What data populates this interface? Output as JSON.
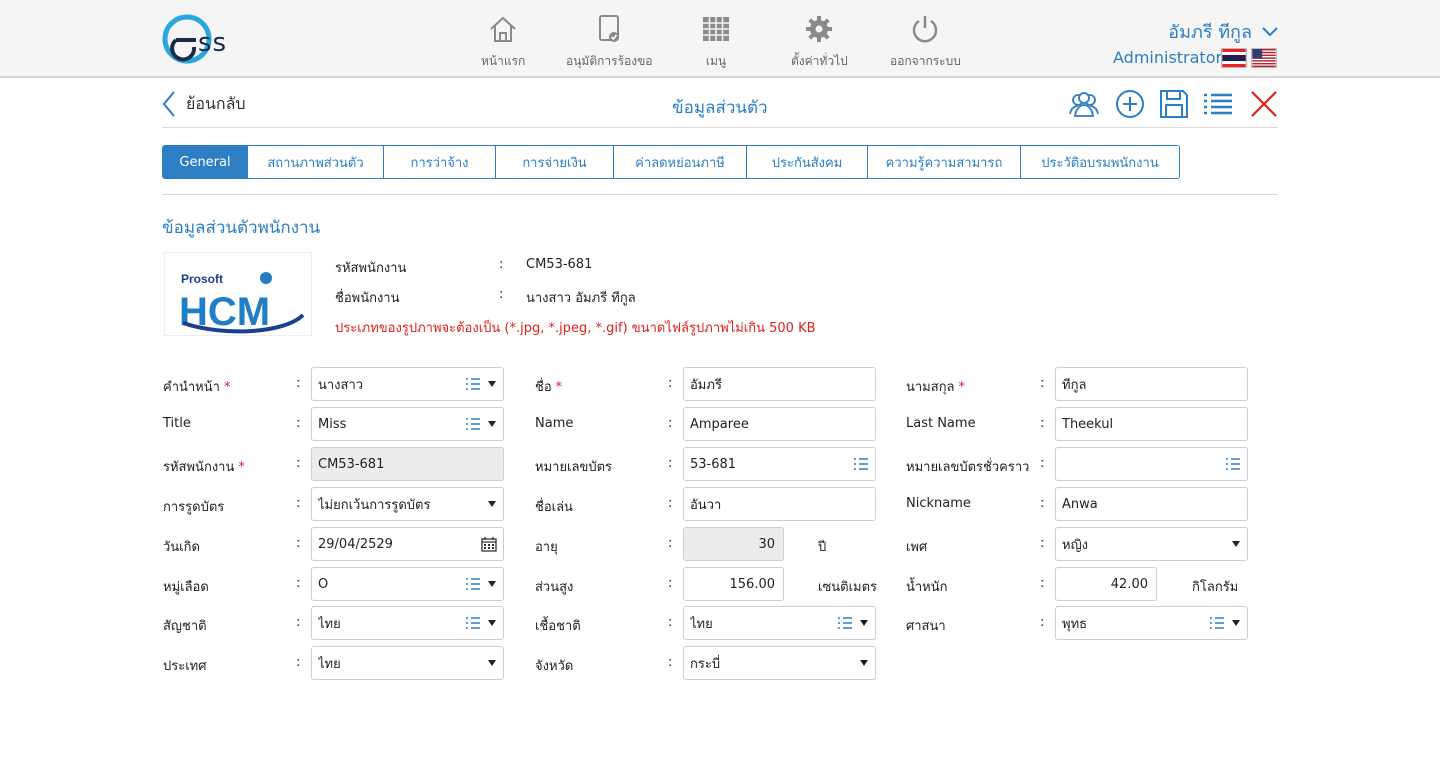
{
  "app": {
    "logo_text": "SS",
    "nav": [
      {
        "label": "หน้าแรก",
        "icon": "home-icon"
      },
      {
        "label": "อนุมัติการร้องขอ",
        "icon": "approve-document-icon"
      },
      {
        "label": "เมนู",
        "icon": "grid-menu-icon"
      },
      {
        "label": "ตั้งค่าทั่วไป",
        "icon": "gear-icon"
      },
      {
        "label": "ออกจากระบบ",
        "icon": "power-icon"
      }
    ],
    "user_name": "อัมภรี  ทีกูล",
    "user_role": "Administrator",
    "accent": "#2d7ec4",
    "error": "#e0211c"
  },
  "subbar": {
    "back_label": "ย้อนกลับ",
    "title": "ข้อมูลส่วนตัว",
    "tools": [
      "group-users-icon",
      "add-circle-icon",
      "save-icon",
      "list-icon",
      "close-icon"
    ]
  },
  "tabs": [
    "General",
    "สถานภาพส่วนตัว",
    "การว่าจ้าง",
    "การจ่ายเงิน",
    "ค่าลดหย่อนภาษี",
    "ประกันสังคม",
    "ความรู้ความสามารถ",
    "ประวัติอบรมพนักงาน"
  ],
  "section_title": "ข้อมูลส่วนตัวพนักงาน",
  "photo": {
    "brand_top": "Prosoft",
    "brand": "HCM"
  },
  "summary": [
    {
      "label": "รหัสพนักงาน",
      "value": "CM53-681"
    },
    {
      "label": "ชื่อพนักงาน",
      "value": "นางสาว  อัมภรี  ทีกูล"
    }
  ],
  "photo_warning": "ประเภทของรูปภาพจะต้องเป็น (*.jpg, *.jpeg, *.gif) ขนาดไฟล์รูปภาพไม่เกิน 500 KB",
  "form": {
    "prefix_th": {
      "label": "คำนำหน้า",
      "value": "นางสาว"
    },
    "first_th": {
      "label": "ชื่อ",
      "value": "อัมภรี"
    },
    "last_th": {
      "label": "นามสกุล",
      "value": "ทีกูล"
    },
    "title_en": {
      "label": "Title",
      "value": "Miss"
    },
    "name_en": {
      "label": "Name",
      "value": "Amparee"
    },
    "last_en": {
      "label": "Last Name",
      "value": "Theekul"
    },
    "emp_code": {
      "label": "รหัสพนักงาน",
      "value": "CM53-681"
    },
    "card_no": {
      "label": "หมายเลขบัตร",
      "value": "53-681"
    },
    "temp_card": {
      "label": "หมายเลขบัตรชั่วคราว",
      "value": ""
    },
    "swipe": {
      "label": "การรูดบัตร",
      "value": "ไม่ยกเว้นการรูดบัตร"
    },
    "nickname_th": {
      "label": "ชื่อเล่น",
      "value": "อันวา"
    },
    "nickname_en": {
      "label": "Nickname",
      "value": "Anwa"
    },
    "birth": {
      "label": "วันเกิด",
      "value": "29/04/2529"
    },
    "age": {
      "label": "อายุ",
      "value": "30",
      "unit": "ปี"
    },
    "gender": {
      "label": "เพศ",
      "value": "หญิง"
    },
    "blood": {
      "label": "หมู่เลือด",
      "value": "O"
    },
    "height": {
      "label": "ส่วนสูง",
      "value": "156.00",
      "unit": "เซนติเมตร"
    },
    "weight": {
      "label": "น้ำหนัก",
      "value": "42.00",
      "unit": "กิโลกรัม"
    },
    "nationality": {
      "label": "สัญชาติ",
      "value": "ไทย"
    },
    "race": {
      "label": "เชื้อชาติ",
      "value": "ไทย"
    },
    "religion": {
      "label": "ศาสนา",
      "value": "พุทธ"
    },
    "country": {
      "label": "ประเทศ",
      "value": "ไทย"
    },
    "province": {
      "label": "จังหวัด",
      "value": "กระบี่"
    }
  }
}
